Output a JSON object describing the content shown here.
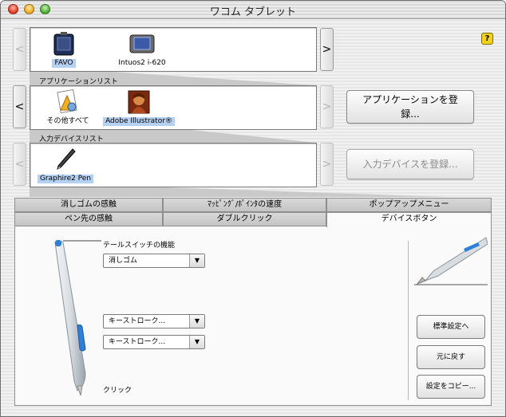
{
  "window": {
    "title": "ワコム タブレット"
  },
  "tablets": {
    "items": [
      {
        "label": "FAVO",
        "icon": "tablet-favo-icon",
        "selected": true
      },
      {
        "label": "Intuos2 i-620",
        "icon": "tablet-intuos-icon",
        "selected": false
      }
    ]
  },
  "applications": {
    "section_label": "アプリケーションリスト",
    "items": [
      {
        "label": "その他すべて",
        "icon": "all-apps-icon",
        "selected": false
      },
      {
        "label": "Adobe Illustrator®",
        "icon": "illustrator-icon",
        "selected": true
      }
    ],
    "register_button": "アプリケーションを登\n録..."
  },
  "devices": {
    "section_label": "入力デバイスリスト",
    "items": [
      {
        "label": "Graphire2 Pen",
        "icon": "pen-icon",
        "selected": true
      }
    ],
    "register_button": "入力デバイスを登録..."
  },
  "help": {
    "label": "?"
  },
  "tabs": {
    "row_back": [
      "消しゴムの感触",
      "ﾏｯﾋﾟﾝｸﾞ/ﾎﾟｲﾝﾀの速度",
      "ポップアップメニュー"
    ],
    "row_front": [
      "ペン先の感触",
      "ダブルクリック",
      "デバイスボタン"
    ],
    "active": "デバイスボタン"
  },
  "panel": {
    "tail_switch_label": "テールスイッチの機能",
    "tail_switch_value": "消しゴム",
    "upper_button_value": "キーストローク...",
    "lower_button_value": "キーストローク...",
    "tip_label": "クリック",
    "default_button": "標準設定へ",
    "revert_button": "元に戻す",
    "copy_button": "設定をコピー..."
  },
  "colors": {
    "selection": "#b5d1f2",
    "accent_blue": "#2f7fd6"
  }
}
